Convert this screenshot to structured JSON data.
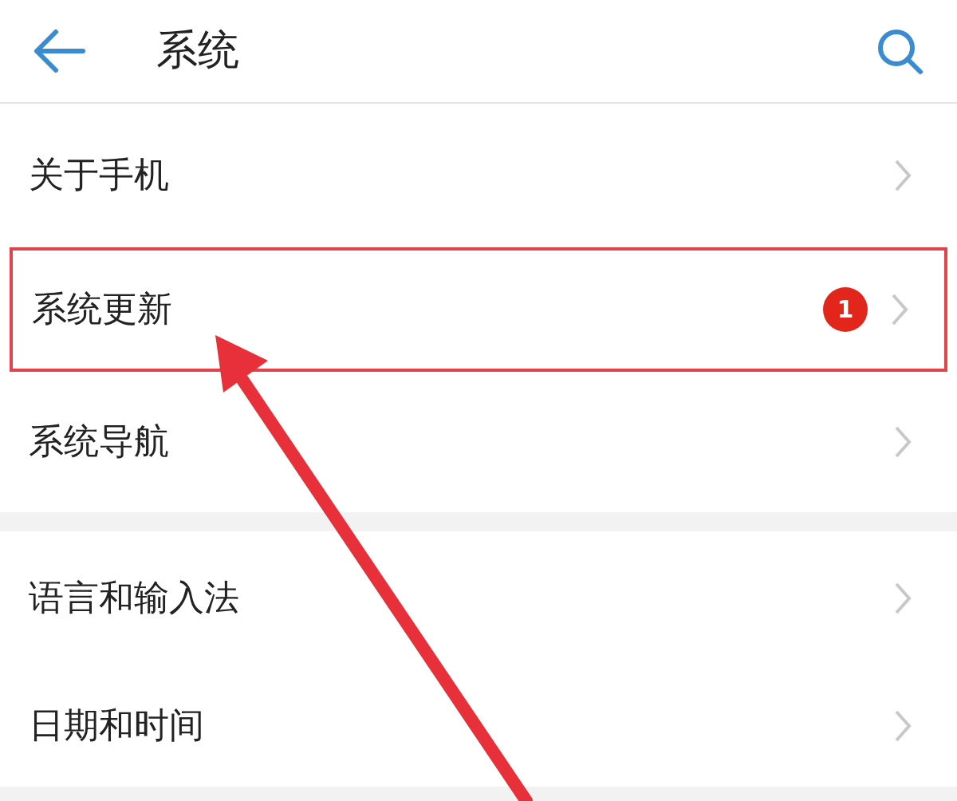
{
  "header": {
    "title": "系统"
  },
  "sections": [
    {
      "items": [
        {
          "label": "关于手机",
          "highlighted": false
        },
        {
          "label": "系统更新",
          "badge": "1",
          "highlighted": true
        },
        {
          "label": "系统导航",
          "highlighted": false
        }
      ]
    },
    {
      "items": [
        {
          "label": "语言和输入法",
          "highlighted": false
        },
        {
          "label": "日期和时间",
          "highlighted": false
        }
      ]
    }
  ]
}
